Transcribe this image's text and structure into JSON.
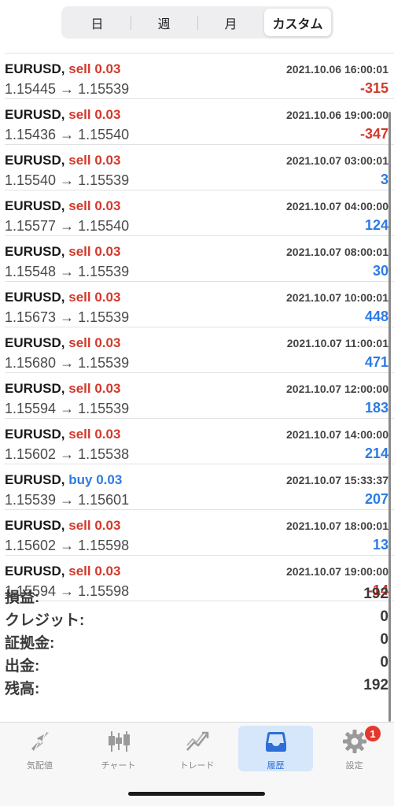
{
  "tabs": [
    {
      "label": "日"
    },
    {
      "label": "週"
    },
    {
      "label": "月"
    },
    {
      "label": "カスタム",
      "active": true
    }
  ],
  "trades": [
    {
      "symbol": "EURUSD,",
      "side": "sell",
      "lots": "0.03",
      "time": "2021.10.06 16:00:01",
      "open": "1.15445",
      "close": "1.15539",
      "profit": "-315",
      "profit_sign": "neg"
    },
    {
      "symbol": "EURUSD,",
      "side": "sell",
      "lots": "0.03",
      "time": "2021.10.06 19:00:00",
      "open": "1.15436",
      "close": "1.15540",
      "profit": "-347",
      "profit_sign": "neg"
    },
    {
      "symbol": "EURUSD,",
      "side": "sell",
      "lots": "0.03",
      "time": "2021.10.07 03:00:01",
      "open": "1.15540",
      "close": "1.15539",
      "profit": "3",
      "profit_sign": "pos"
    },
    {
      "symbol": "EURUSD,",
      "side": "sell",
      "lots": "0.03",
      "time": "2021.10.07 04:00:00",
      "open": "1.15577",
      "close": "1.15540",
      "profit": "124",
      "profit_sign": "pos"
    },
    {
      "symbol": "EURUSD,",
      "side": "sell",
      "lots": "0.03",
      "time": "2021.10.07 08:00:01",
      "open": "1.15548",
      "close": "1.15539",
      "profit": "30",
      "profit_sign": "pos"
    },
    {
      "symbol": "EURUSD,",
      "side": "sell",
      "lots": "0.03",
      "time": "2021.10.07 10:00:01",
      "open": "1.15673",
      "close": "1.15539",
      "profit": "448",
      "profit_sign": "pos"
    },
    {
      "symbol": "EURUSD,",
      "side": "sell",
      "lots": "0.03",
      "time": "2021.10.07 11:00:01",
      "open": "1.15680",
      "close": "1.15539",
      "profit": "471",
      "profit_sign": "pos"
    },
    {
      "symbol": "EURUSD,",
      "side": "sell",
      "lots": "0.03",
      "time": "2021.10.07 12:00:00",
      "open": "1.15594",
      "close": "1.15539",
      "profit": "183",
      "profit_sign": "pos"
    },
    {
      "symbol": "EURUSD,",
      "side": "sell",
      "lots": "0.03",
      "time": "2021.10.07 14:00:00",
      "open": "1.15602",
      "close": "1.15538",
      "profit": "214",
      "profit_sign": "pos"
    },
    {
      "symbol": "EURUSD,",
      "side": "buy",
      "lots": "0.03",
      "time": "2021.10.07 15:33:37",
      "open": "1.15539",
      "close": "1.15601",
      "profit": "207",
      "profit_sign": "pos"
    },
    {
      "symbol": "EURUSD,",
      "side": "sell",
      "lots": "0.03",
      "time": "2021.10.07 18:00:01",
      "open": "1.15602",
      "close": "1.15598",
      "profit": "13",
      "profit_sign": "pos"
    },
    {
      "symbol": "EURUSD,",
      "side": "sell",
      "lots": "0.03",
      "time": "2021.10.07 19:00:00",
      "open": "1.15594",
      "close": "1.15598",
      "profit": "-14",
      "profit_sign": "neg"
    }
  ],
  "summary": [
    {
      "label": "損益:",
      "value": "192"
    },
    {
      "label": "クレジット:",
      "value": "0"
    },
    {
      "label": "証拠金:",
      "value": "0"
    },
    {
      "label": "出金:",
      "value": "0"
    },
    {
      "label": "残高:",
      "value": "192"
    }
  ],
  "bottom_nav": [
    {
      "label": "気配値",
      "icon": "quotes-icon"
    },
    {
      "label": "チャート",
      "icon": "candlestick-chart-icon"
    },
    {
      "label": "トレード",
      "icon": "trade-icon"
    },
    {
      "label": "履歴",
      "icon": "history-inbox-icon",
      "active": true
    },
    {
      "label": "設定",
      "icon": "gear-icon",
      "badge": "1"
    }
  ],
  "colors": {
    "sell": "#d2392b",
    "buy": "#2d7be5",
    "active_tab_bg": "#d7e7fb",
    "active_tab_text": "#2d6fd6",
    "badge": "#e5372c"
  }
}
